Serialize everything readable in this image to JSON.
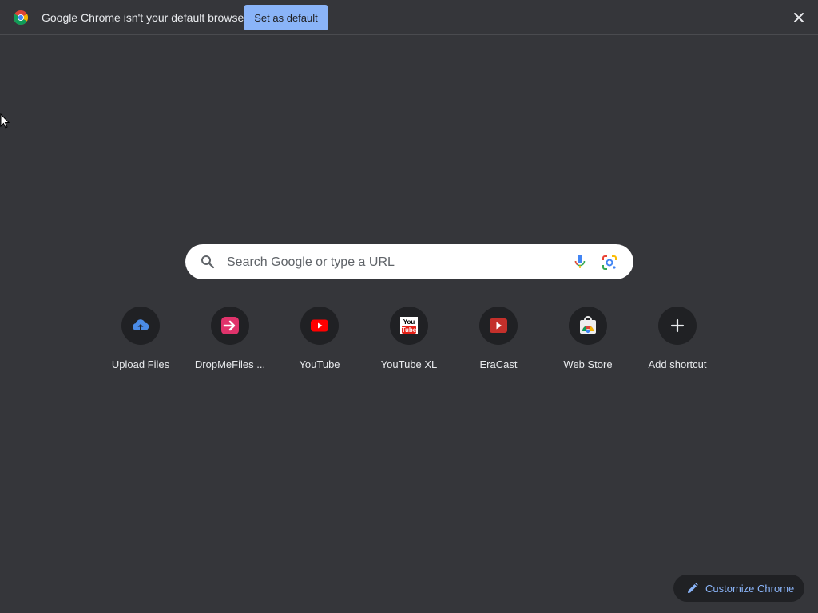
{
  "infobar": {
    "message": "Google Chrome isn't your default browser",
    "button_label": "Set as default"
  },
  "search": {
    "placeholder": "Search Google or type a URL"
  },
  "shortcuts": [
    {
      "label": "Upload Files",
      "icon": "upload-cloud-icon"
    },
    {
      "label": "DropMeFiles ...",
      "icon": "dropmefiles-icon"
    },
    {
      "label": "YouTube",
      "icon": "youtube-icon"
    },
    {
      "label": "YouTube XL",
      "icon": "youtube-xl-icon"
    },
    {
      "label": "EraCast",
      "icon": "eracast-icon"
    },
    {
      "label": "Web Store",
      "icon": "web-store-icon"
    },
    {
      "label": "Add shortcut",
      "icon": "plus-icon"
    }
  ],
  "customize": {
    "label": "Customize Chrome"
  },
  "colors": {
    "background": "#35363a",
    "accent": "#8ab4f8",
    "tile_background": "#202124"
  }
}
